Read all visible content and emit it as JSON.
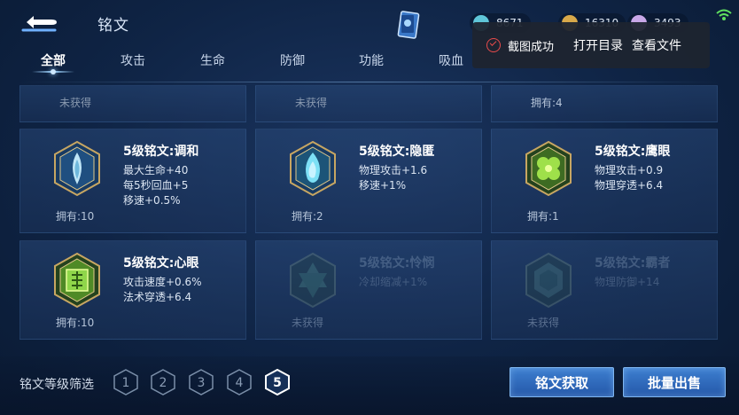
{
  "header": {
    "title": "铭文",
    "currencies": [
      {
        "name": "diamond",
        "value": "8671",
        "color": "#5fc6d8"
      },
      {
        "name": "gold-coin",
        "value": "16310",
        "color": "#d8a94a"
      },
      {
        "name": "crystal",
        "value": "3493",
        "color": "#c9a8e8"
      }
    ]
  },
  "tabs": [
    {
      "label": "全部",
      "active": true
    },
    {
      "label": "攻击"
    },
    {
      "label": "生命"
    },
    {
      "label": "防御"
    },
    {
      "label": "功能"
    },
    {
      "label": "吸血"
    }
  ],
  "toast": {
    "message": "截图成功",
    "open_folder": "打开目录",
    "view_file": "查看文件"
  },
  "top_row": [
    {
      "status": "未获得"
    },
    {
      "status": "未获得"
    },
    {
      "status": "拥有:4"
    }
  ],
  "inscriptions": [
    {
      "name": "5级铭文:调和",
      "stats": [
        "最大生命+40",
        "每5秒回血+5",
        "移速+0.5%"
      ],
      "owned": "拥有:10",
      "color": "#9ad0e8",
      "locked": false
    },
    {
      "name": "5级铭文:隐匿",
      "stats": [
        "物理攻击+1.6",
        "移速+1%"
      ],
      "owned": "拥有:2",
      "color": "#6fd6ef",
      "locked": false
    },
    {
      "name": "5级铭文:鹰眼",
      "stats": [
        "物理攻击+0.9",
        "物理穿透+6.4"
      ],
      "owned": "拥有:1",
      "color": "#8fd64a",
      "locked": false
    },
    {
      "name": "5级铭文:心眼",
      "stats": [
        "攻击速度+0.6%",
        "法术穿透+6.4"
      ],
      "owned": "拥有:10",
      "color": "#7fd04a",
      "locked": false
    },
    {
      "name": "5级铭文:怜悯",
      "stats": [
        "冷却缩减+1%"
      ],
      "owned": "未获得",
      "color": "#5fa88a",
      "locked": true
    },
    {
      "name": "5级铭文:霸者",
      "stats": [
        "物理防御+14"
      ],
      "owned": "未获得",
      "color": "#5f9a8a",
      "locked": true
    }
  ],
  "filter": {
    "label": "铭文等级筛选",
    "levels": [
      "1",
      "2",
      "3",
      "4",
      "5"
    ],
    "selected": "5"
  },
  "buttons": {
    "obtain": "铭文获取",
    "bulk_sell": "批量出售"
  }
}
